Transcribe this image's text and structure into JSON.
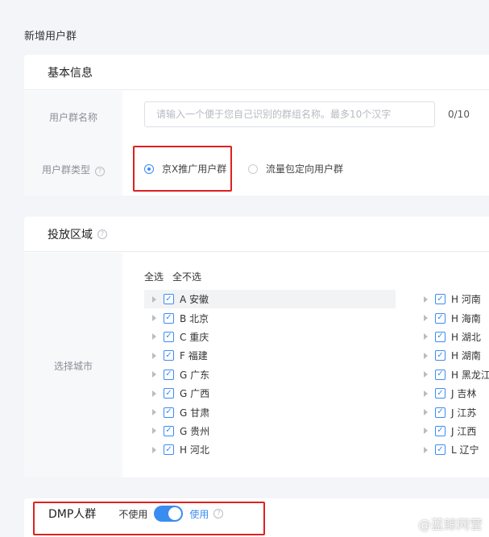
{
  "page": {
    "title": "新增用户群"
  },
  "basic": {
    "header": "基本信息",
    "name_label": "用户群名称",
    "name_placeholder": "请输入一个便于您自己识别的群组名称。最多10个汉字",
    "name_counter": "0/10",
    "type_label": "用户群类型",
    "type_options": [
      {
        "label": "京X推广用户群",
        "checked": true
      },
      {
        "label": "流量包定向用户群",
        "checked": false
      }
    ]
  },
  "region": {
    "header": "投放区域",
    "city_label": "选择城市",
    "select_all": "全选",
    "select_none": "全不选",
    "left_column": [
      "A 安徽",
      "B 北京",
      "C 重庆",
      "F 福建",
      "G 广东",
      "G 广西",
      "G 甘肃",
      "G 贵州",
      "H 河北"
    ],
    "right_column": [
      "H 河南",
      "H 海南",
      "H 湖北",
      "H 湖南",
      "H 黑龙江",
      "J 吉林",
      "J 江苏",
      "J 江西",
      "L 辽宁"
    ]
  },
  "dmp": {
    "label": "DMP人群",
    "off_label": "不使用",
    "on_label": "使用",
    "enabled": true
  },
  "watermark": "@蓝鲸网营",
  "colors": {
    "accent": "#3b8cf0",
    "highlight": "#e0201f"
  }
}
